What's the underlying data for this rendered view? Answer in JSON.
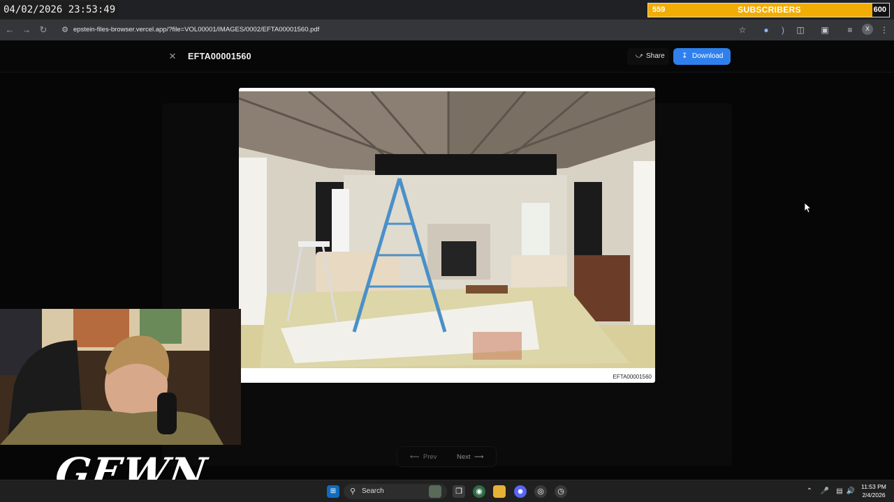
{
  "overlay": {
    "clock": "04/02/2026 23:53:49",
    "subscribers": {
      "current": "559",
      "label": "SUBSCRIBERS",
      "goal": "600",
      "progress": 0.93
    },
    "brand": "GEWN"
  },
  "browser": {
    "url": "epstein-files-browser.vercel.app/?file=VOL00001/IMAGES/0002/EFTA00001560.pdf",
    "profile_initial": "X"
  },
  "viewer": {
    "title": "EFTA00001560",
    "share_label": "Share",
    "download_label": "Download",
    "caption": "EFTA00001560",
    "prev_label": "Prev",
    "next_label": "Next"
  },
  "taskbar": {
    "search_label": "Search",
    "time": "11:53 PM",
    "date": "2/4/2026"
  },
  "colors": {
    "accent": "#2f80ed",
    "sub_bar": "#f2ad05"
  }
}
